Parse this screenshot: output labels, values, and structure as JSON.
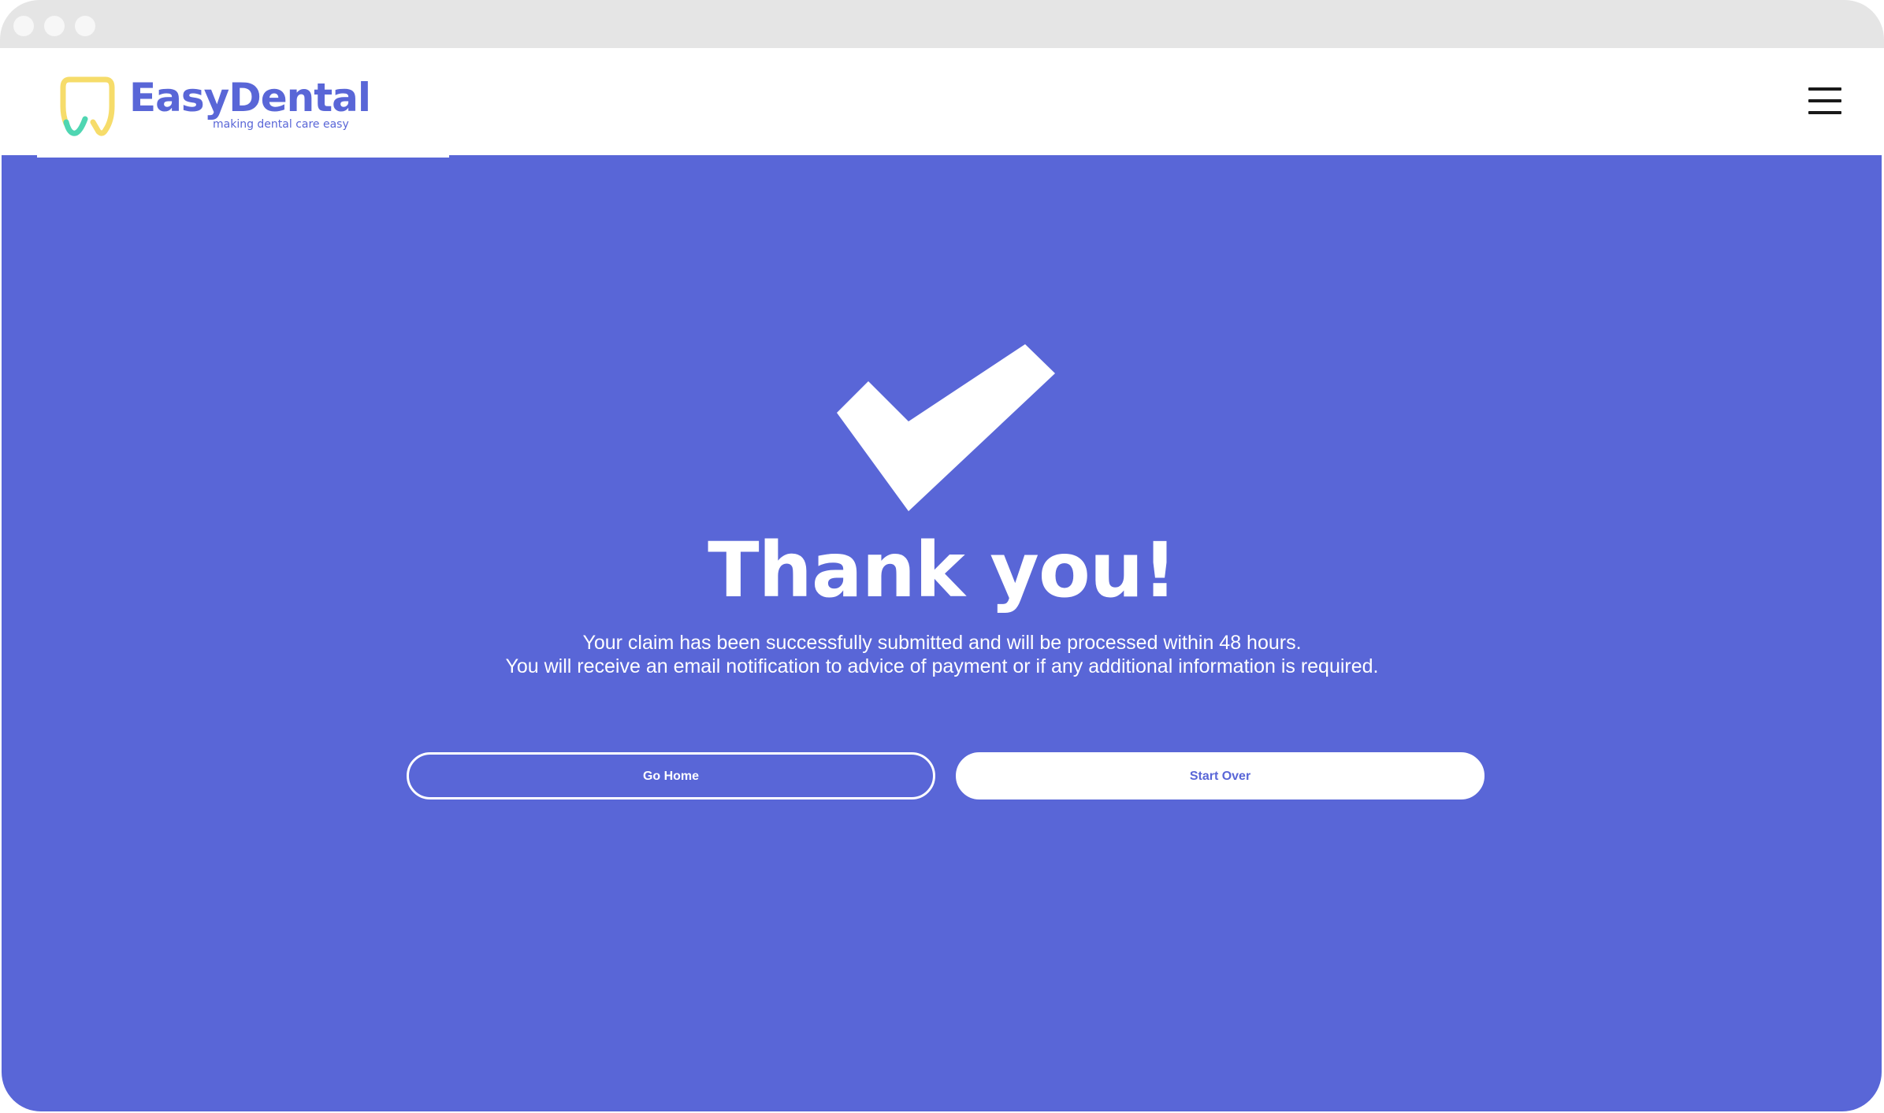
{
  "colors": {
    "brand": "#5966d7",
    "logo_yellow": "#f6dc6a",
    "logo_green": "#4fd6b2",
    "titlebar": "#e5e5e5"
  },
  "header": {
    "brand_name": "EasyDental",
    "tagline": "making dental care easy",
    "logo_icon": "tooth-icon",
    "menu_icon": "hamburger-menu-icon"
  },
  "confirmation": {
    "icon": "checkmark-icon",
    "title": "Thank you!",
    "message_line1": "Your claim has been successfully submitted and will be processed within 48 hours.",
    "message_line2": "You will receive an email notification to advice of payment or if any additional information is required."
  },
  "actions": {
    "go_home_label": "Go Home",
    "start_over_label": "Start Over"
  }
}
